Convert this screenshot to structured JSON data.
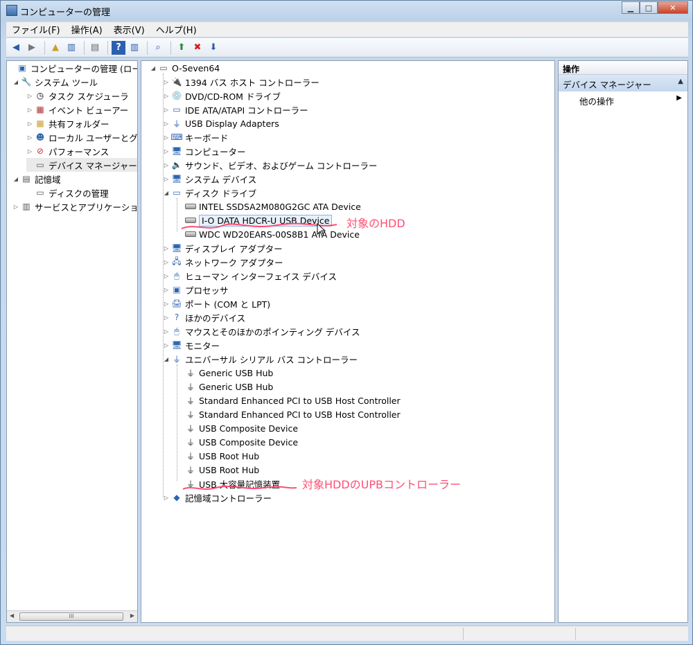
{
  "window": {
    "title": "コンピューターの管理",
    "min": "▁",
    "max": "□",
    "close": "✕"
  },
  "menu": [
    "ファイル(F)",
    "操作(A)",
    "表示(V)",
    "ヘルプ(H)"
  ],
  "left_tree": {
    "root": "コンピューターの管理 (ローカ",
    "system_tools": "システム ツール",
    "task_scheduler": "タスク スケジューラ",
    "event_viewer": "イベント ビューアー",
    "shared_folders": "共有フォルダー",
    "local_users": "ローカル ユーザーとグ",
    "performance": "パフォーマンス",
    "device_manager": "デバイス マネージャー",
    "storage": "記憶域",
    "disk_management": "ディスクの管理",
    "services_apps": "サービスとアプリケーショ"
  },
  "device_tree": {
    "computer": "O-Seven64",
    "categories": [
      "1394 バス ホスト コントローラー",
      "DVD/CD-ROM ドライブ",
      "IDE ATA/ATAPI コントローラー",
      "USB Display Adapters",
      "キーボード",
      "コンピューター",
      "サウンド、ビデオ、およびゲーム コントローラー",
      "システム デバイス",
      "ディスク ドライブ",
      "ディスプレイ アダプター",
      "ネットワーク アダプター",
      "ヒューマン インターフェイス デバイス",
      "プロセッサ",
      "ポート (COM と LPT)",
      "ほかのデバイス",
      "マウスとそのほかのポインティング デバイス",
      "モニター",
      "ユニバーサル シリアル バス コントローラー",
      "記憶域コントローラー"
    ],
    "disk_drives": [
      "INTEL SSDSA2M080G2GC ATA Device",
      "I-O DATA HDCR-U USB Device",
      "WDC WD20EARS-00S8B1 ATA Device"
    ],
    "usb_controllers": [
      "Generic USB Hub",
      "Generic USB Hub",
      "Standard Enhanced PCI to USB Host Controller",
      "Standard Enhanced PCI to USB Host Controller",
      "USB Composite Device",
      "USB Composite Device",
      "USB Root Hub",
      "USB Root Hub",
      "USB 大容量記憶装置"
    ]
  },
  "annotations": {
    "target_hdd": "対象のHDD",
    "target_usb": "対象HDDのUPBコントローラー"
  },
  "actions": {
    "header": "操作",
    "selected": "デバイス マネージャー",
    "more": "他の操作"
  },
  "scroll": {
    "grip": "III"
  }
}
